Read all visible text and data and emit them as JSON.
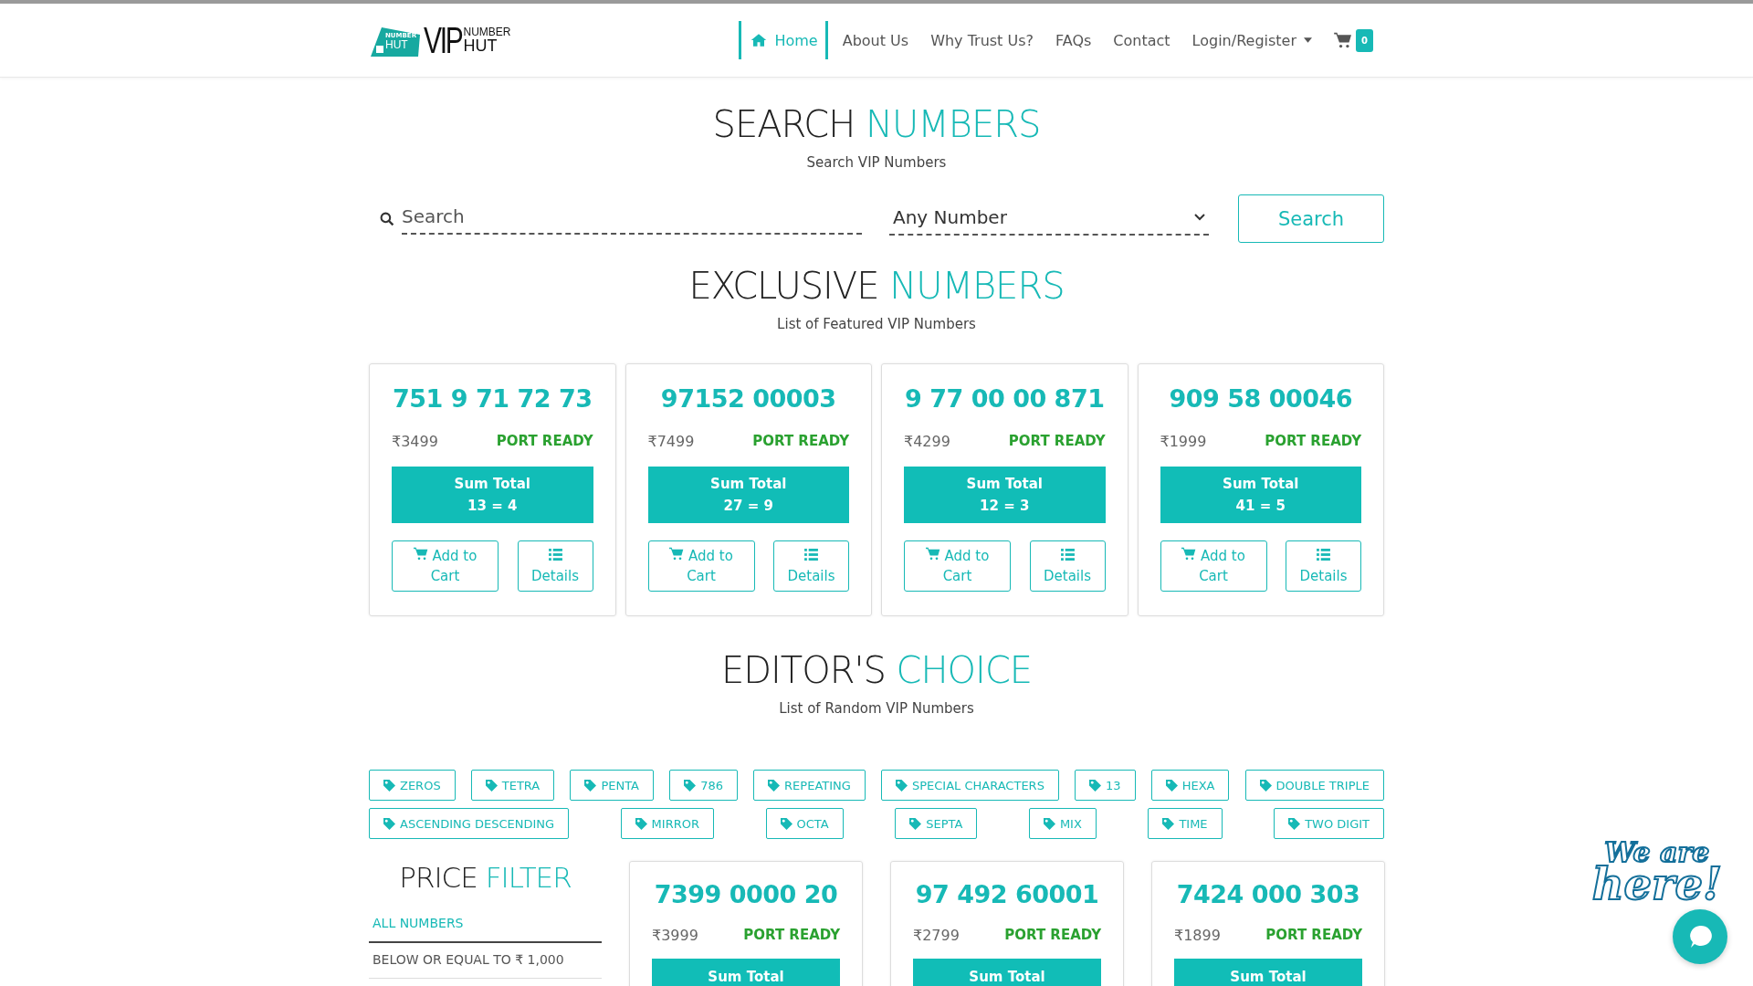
{
  "header": {
    "logo": {
      "badge_top": "NUMBER",
      "badge_bottom": "HUT",
      "vip": "VIP",
      "word_top": "NUMBER",
      "word_bottom": "HUT"
    },
    "nav": [
      {
        "label": "Home",
        "selected": true,
        "kind": "home"
      },
      {
        "label": "About Us",
        "selected": false,
        "kind": "link"
      },
      {
        "label": "Why Trust Us?",
        "selected": false,
        "kind": "link"
      },
      {
        "label": "FAQs",
        "selected": false,
        "kind": "link"
      },
      {
        "label": "Contact",
        "selected": false,
        "kind": "link"
      },
      {
        "label": "Login/Register",
        "selected": false,
        "kind": "dropdown"
      }
    ],
    "cart_count": "0"
  },
  "search_section": {
    "title_dark": "SEARCH",
    "title_accent": "NUMBERS",
    "subtitle": "Search VIP Numbers",
    "search": {
      "placeholder": "Search"
    },
    "select": {
      "value": "Any Number"
    },
    "button": "Search"
  },
  "exclusive": {
    "title_dark": "EXCLUSIVE",
    "title_accent": "NUMBERS",
    "subtitle": "List of Featured VIP Numbers",
    "cards": [
      {
        "number": "751 9 71 72 73",
        "price": "₹3499",
        "status": "PORT READY",
        "sum_label": "Sum Total",
        "sum_value": "13 = 4",
        "add": "Add to Cart",
        "details": "Details"
      },
      {
        "number": "97152 00003",
        "price": "₹7499",
        "status": "PORT READY",
        "sum_label": "Sum Total",
        "sum_value": "27 = 9",
        "add": "Add to Cart",
        "details": "Details"
      },
      {
        "number": "9 77 00 00 871",
        "price": "₹4299",
        "status": "PORT READY",
        "sum_label": "Sum Total",
        "sum_value": "12 = 3",
        "add": "Add to Cart",
        "details": "Details"
      },
      {
        "number": "909 58 00046",
        "price": "₹1999",
        "status": "PORT READY",
        "sum_label": "Sum Total",
        "sum_value": "41 = 5",
        "add": "Add to Cart",
        "details": "Details"
      }
    ]
  },
  "editors_choice": {
    "title_dark": "EDITOR'S",
    "title_accent": "CHOICE",
    "subtitle": "List of Random VIP Numbers",
    "tag_rows": [
      {
        "tags": [
          "ZEROS",
          "TETRA",
          "PENTA",
          "786",
          "REPEATING",
          "SPECIAL CHARACTERS",
          "13",
          "HEXA",
          "DOUBLE TRIPLE"
        ]
      },
      {
        "tags": [
          "ASCENDING DESCENDING",
          "MIRROR",
          "OCTA",
          "SEPTA",
          "MIX",
          "TIME",
          "TWO DIGIT"
        ]
      }
    ]
  },
  "price_filter": {
    "title_dark": "PRICE",
    "title_accent": "FILTER",
    "items": [
      {
        "label": "ALL NUMBERS",
        "selected": true
      },
      {
        "label": "BELOW OR EQUAL TO ₹ 1,000",
        "selected": false
      }
    ]
  },
  "listing": [
    {
      "number": "7399 0000 20",
      "price": "₹3999",
      "status": "PORT READY",
      "sum_label": "Sum Total"
    },
    {
      "number": "97 492 60001",
      "price": "₹2799",
      "status": "PORT READY",
      "sum_label": "Sum Total"
    },
    {
      "number": "7424 000 303",
      "price": "₹1899",
      "status": "PORT READY",
      "sum_label": "Sum Total"
    }
  ],
  "chat": {
    "line1": "We are",
    "line2": "here!"
  }
}
